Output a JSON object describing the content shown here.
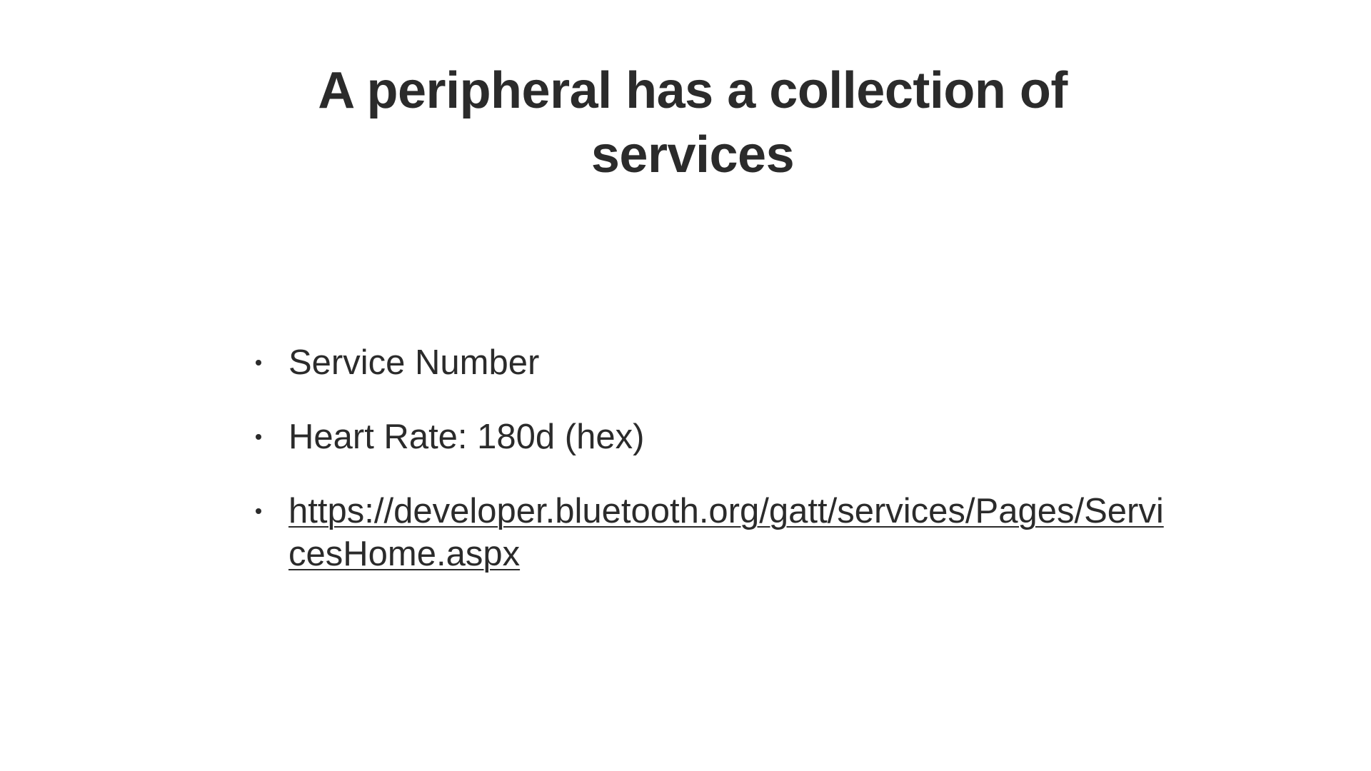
{
  "slide": {
    "title": "A peripheral has a collection of services",
    "bullets": [
      {
        "text": "Service Number"
      },
      {
        "text": "Heart Rate: 180d (hex)"
      },
      {
        "text": "https://developer.bluetooth.org/gatt/services/Pages/ServicesHome.aspx"
      }
    ]
  },
  "colors": {
    "background": "#ffffff",
    "text": "#2b2b2b"
  }
}
